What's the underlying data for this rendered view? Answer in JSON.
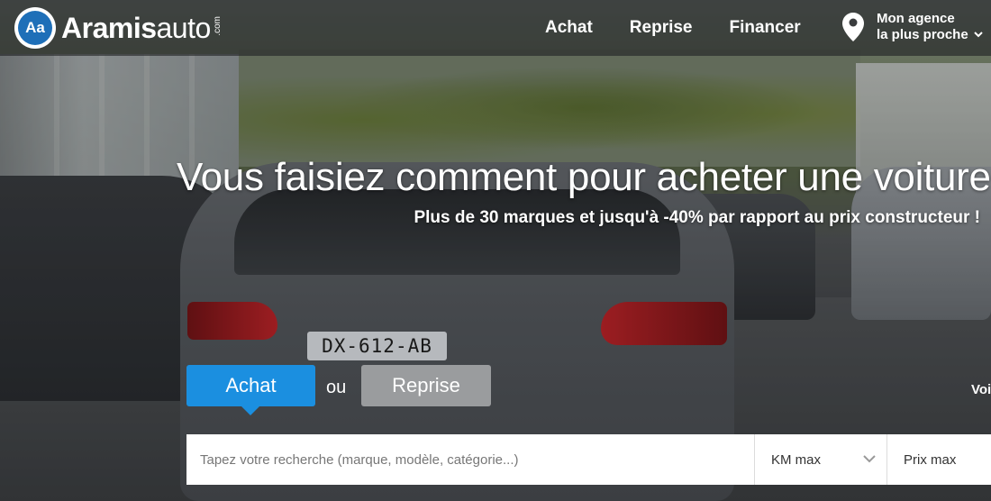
{
  "brand": {
    "badge": "Aa",
    "name_bold": "Aramis",
    "name_light": "auto",
    "suffix": ".com"
  },
  "nav": {
    "items": [
      "Achat",
      "Reprise",
      "Financer"
    ]
  },
  "agency": {
    "line1": "Mon agence",
    "line2": "la plus proche"
  },
  "hero": {
    "headline": "Vous faisiez comment pour acheter une voiture",
    "subline": "Plus de 30 marques et jusqu'à -40% par rapport au prix constructeur !",
    "plate": "DX-612-AB"
  },
  "tabs": {
    "achat": "Achat",
    "separator": "ou",
    "reprise": "Reprise"
  },
  "side_link": "Voi",
  "search": {
    "placeholder": "Tapez votre recherche (marque, modèle, catégorie...)",
    "km_label": "KM max",
    "price_label": "Prix max"
  },
  "colors": {
    "accent": "#1b8fe0",
    "secondary_tab": "#9a9c9e",
    "brand_blue": "#1e6fb8"
  }
}
